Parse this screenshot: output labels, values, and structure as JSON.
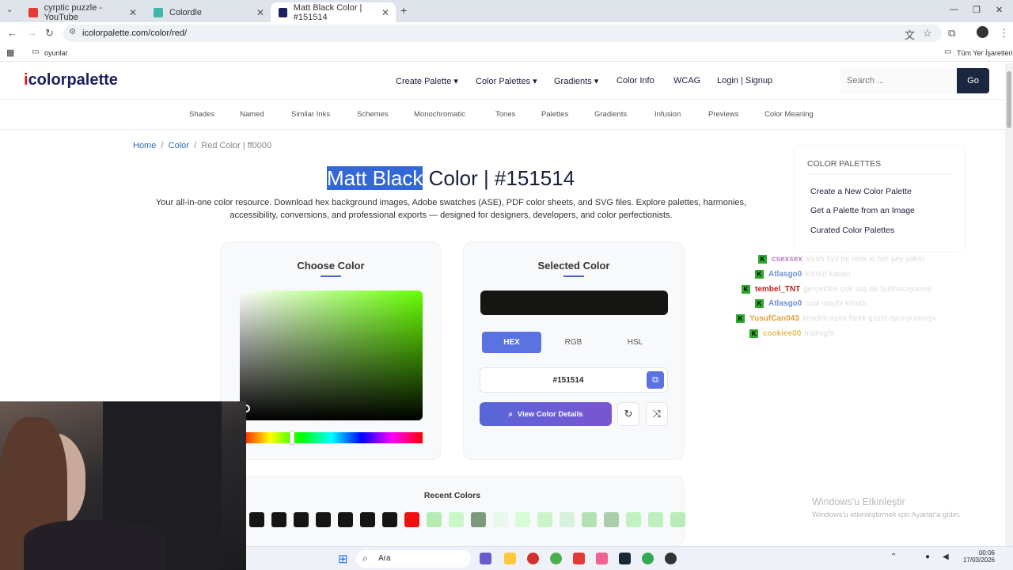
{
  "browser": {
    "tabs": [
      {
        "title": "cyrptic puzzle - YouTube",
        "icon": "youtube-icon",
        "color": "#e53935"
      },
      {
        "title": "Colordle",
        "icon": "colordle-icon",
        "color": "#3fb6a8"
      },
      {
        "title": "Matt Black Color | #151514",
        "icon": "icolorpalette-icon",
        "color": "#1b1f5e"
      }
    ],
    "url": "icolorpalette.com/color/red/",
    "bookmark_folder": "oyunlar",
    "all_bookmarks": "Tüm Yer İşaretleri"
  },
  "site": {
    "logo_i": "i",
    "logo_rest": "colorpalette",
    "nav": [
      "Create Palette",
      "Color Palettes",
      "Gradients",
      "Color Info",
      "WCAG",
      "Login | Signup"
    ],
    "search_placeholder": "Search ...",
    "go": "Go",
    "subnav": [
      "Shades",
      "Named",
      "Similar Inks",
      "Schemes",
      "Monochromatic",
      "Tones",
      "Palettes",
      "Gradients",
      "Infusion",
      "Previews",
      "Color Meaning"
    ],
    "breadcrumb": {
      "home": "Home",
      "color": "Color",
      "current": "Red Color | ff0000",
      "sep": "/"
    },
    "title_highlight": "Matt Black",
    "title_rest": " Color | #151514",
    "intro": "Your all-in-one color resource. Download hex background images, Adobe swatches (ASE), PDF color sheets, and SVG files. Explore palettes, harmonies, accessibility, conversions, and professional exports — designed for designers, developers, and color perfectionists.",
    "choose_color": "Choose Color",
    "selected_color": "Selected Color",
    "selected_hex_color": "#151514",
    "formats": [
      "HEX",
      "RGB",
      "HSL"
    ],
    "hex_value": "#151514",
    "view_details": "View Color Details",
    "recent_colors_title": "Recent Colors",
    "recent_colors": [
      "#151514",
      "#151514",
      "#151514",
      "#151514",
      "#151514",
      "#151514",
      "#151514",
      "#ee1111",
      "#b4ecb4",
      "#c8f7c8",
      "#7a9a7a",
      "#e8f8ec",
      "#d8fbd8",
      "#c8f4c8",
      "#d6f2dc",
      "#b2e2b2",
      "#a9cea9",
      "#c0f3c0",
      "#bdf0bd",
      "#b8ecb8"
    ],
    "side_panel": {
      "heading": "COLOR PALETTES",
      "links": [
        "Create a New Color Palette",
        "Get a Palette from an Image",
        "Curated Color Palettes"
      ]
    }
  },
  "chat": [
    {
      "user": "csexsex",
      "color": "#c080c8",
      "msg": "siyah 5yıl bir renk ki her şey yakın"
    },
    {
      "user": "Atlasgo0",
      "color": "#6a8fd8",
      "msg": "kömür karası"
    },
    {
      "user": "tembel_TNT",
      "color": "#b8241c",
      "msg": "gerçekten çok süş bir bulmacayamış"
    },
    {
      "user": "Atlasgo0",
      "color": "#6a8fd8",
      "msg": "coal maybi kömür"
    },
    {
      "user": "YusufCan043",
      "color": "#e8a040",
      "msg": "kesdim aşım farkk güzel oyunyunmışx"
    },
    {
      "user": "cookiee00",
      "color": "#e0c060",
      "msg": "midnight"
    }
  ],
  "windows": {
    "activate_title": "Windows'u Etkinleştir",
    "activate_sub": "Windows'u etkinleştirmek için Ayarlar'a gidin.",
    "search": "Ara",
    "time": "00:06",
    "date": "17/03/2026"
  }
}
